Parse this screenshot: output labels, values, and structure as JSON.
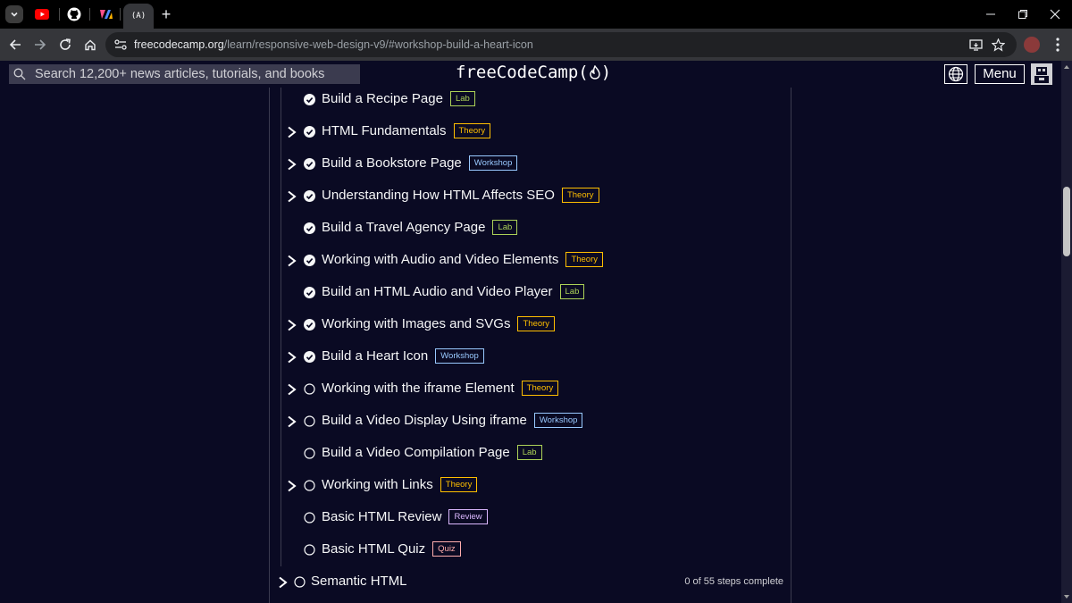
{
  "browser": {
    "url_host": "freecodecamp.org",
    "url_path": "/learn/responsive-web-design-v9/#workshop-build-a-heart-icon",
    "active_tab_icon_text": "(A)"
  },
  "fcc_nav": {
    "search_placeholder": "Search 12,200+ news articles, tutorials, and books",
    "logo_text": "freeCodeCamp(",
    "logo_text_end": ")",
    "menu_label": "Menu"
  },
  "colors": {
    "background": "#0a0a23",
    "panel_border": "#3b3b4f",
    "lab": "#acd157",
    "theory": "#ffbf00",
    "workshop": "#99c9ff",
    "review": "#dbb8ff",
    "quiz": "#ffadad"
  },
  "curriculum": {
    "items": [
      {
        "title": "Build a Recipe Page",
        "badge": "Lab",
        "kind": "lab",
        "expandable": false,
        "complete": true
      },
      {
        "title": "HTML Fundamentals",
        "badge": "Theory",
        "kind": "theory",
        "expandable": true,
        "complete": true
      },
      {
        "title": "Build a Bookstore Page",
        "badge": "Workshop",
        "kind": "workshop",
        "expandable": true,
        "complete": true
      },
      {
        "title": "Understanding How HTML Affects SEO",
        "badge": "Theory",
        "kind": "theory",
        "expandable": true,
        "complete": true
      },
      {
        "title": "Build a Travel Agency Page",
        "badge": "Lab",
        "kind": "lab",
        "expandable": false,
        "complete": true
      },
      {
        "title": "Working with Audio and Video Elements",
        "badge": "Theory",
        "kind": "theory",
        "expandable": true,
        "complete": true
      },
      {
        "title": "Build an HTML Audio and Video Player",
        "badge": "Lab",
        "kind": "lab",
        "expandable": false,
        "complete": true
      },
      {
        "title": "Working with Images and SVGs",
        "badge": "Theory",
        "kind": "theory",
        "expandable": true,
        "complete": true
      },
      {
        "title": "Build a Heart Icon",
        "badge": "Workshop",
        "kind": "workshop",
        "expandable": true,
        "complete": true
      },
      {
        "title": "Working with the iframe Element",
        "badge": "Theory",
        "kind": "theory",
        "expandable": true,
        "complete": false
      },
      {
        "title": "Build a Video Display Using iframe",
        "badge": "Workshop",
        "kind": "workshop",
        "expandable": true,
        "complete": false
      },
      {
        "title": "Build a Video Compilation Page",
        "badge": "Lab",
        "kind": "lab",
        "expandable": false,
        "complete": false
      },
      {
        "title": "Working with Links",
        "badge": "Theory",
        "kind": "theory",
        "expandable": true,
        "complete": false
      },
      {
        "title": "Basic HTML Review",
        "badge": "Review",
        "kind": "review",
        "expandable": false,
        "complete": false
      },
      {
        "title": "Basic HTML Quiz",
        "badge": "Quiz",
        "kind": "quiz",
        "expandable": false,
        "complete": false
      }
    ],
    "next_block": {
      "title": "Semantic HTML",
      "progress": "0 of 55 steps complete"
    }
  }
}
